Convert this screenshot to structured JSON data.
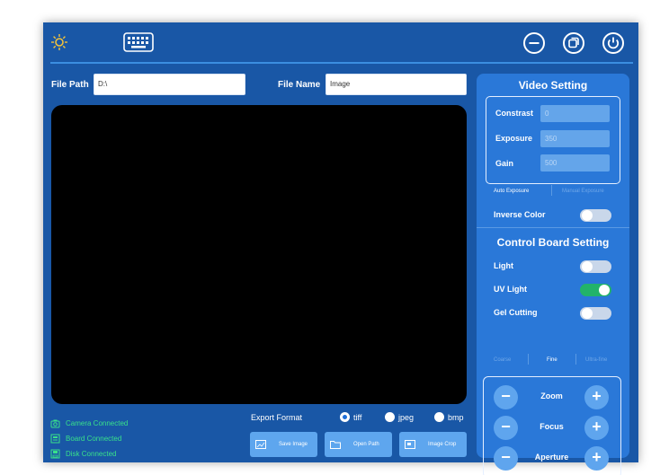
{
  "topbar": {
    "icons": [
      "sun-icon",
      "keyboard-icon",
      "minimize-icon",
      "restore-icon",
      "power-icon"
    ]
  },
  "file": {
    "path_label": "File Path",
    "path_value": "D:\\",
    "name_label": "File Name",
    "name_value": "Image"
  },
  "status": [
    {
      "icon": "camera-icon",
      "text": "Camera Connected"
    },
    {
      "icon": "board-icon",
      "text": "Board Connected"
    },
    {
      "icon": "disk-icon",
      "text": "Disk Connected"
    }
  ],
  "export": {
    "label": "Export Format",
    "options": [
      "tiff",
      "jpeg",
      "bmp"
    ],
    "selected": "tiff"
  },
  "actions": [
    "Save Image",
    "Open Path",
    "Image Crop"
  ],
  "video_setting": {
    "title": "Video Setting",
    "contrast_label": "Constrast",
    "contrast_value": "0",
    "exposure_label": "Exposure",
    "exposure_value": "350",
    "gain_label": "Gain",
    "gain_value": "500",
    "auto_exposure": "Auto Exposure",
    "manual_exposure": "Manual Exposure",
    "inverse_color_label": "Inverse Color",
    "inverse_color_on": false
  },
  "control_board": {
    "title": "Control Board Setting",
    "light_label": "Light",
    "light_on": false,
    "uv_label": "UV Light",
    "uv_on": true,
    "gel_label": "Gel Cutting",
    "gel_on": false,
    "speeds": [
      "Coarse",
      "Fine",
      "Ultra-fine"
    ],
    "selected_speed": "Fine",
    "zoom_label": "Zoom",
    "focus_label": "Focus",
    "aperture_label": "Aperture",
    "minus_symbol": "−",
    "plus_symbol": "+"
  },
  "colors": {
    "app_bg": "#1957a6",
    "panel_bg": "#2a78d8",
    "status_green": "#39e08a",
    "toggle_on": "#22b36a"
  }
}
